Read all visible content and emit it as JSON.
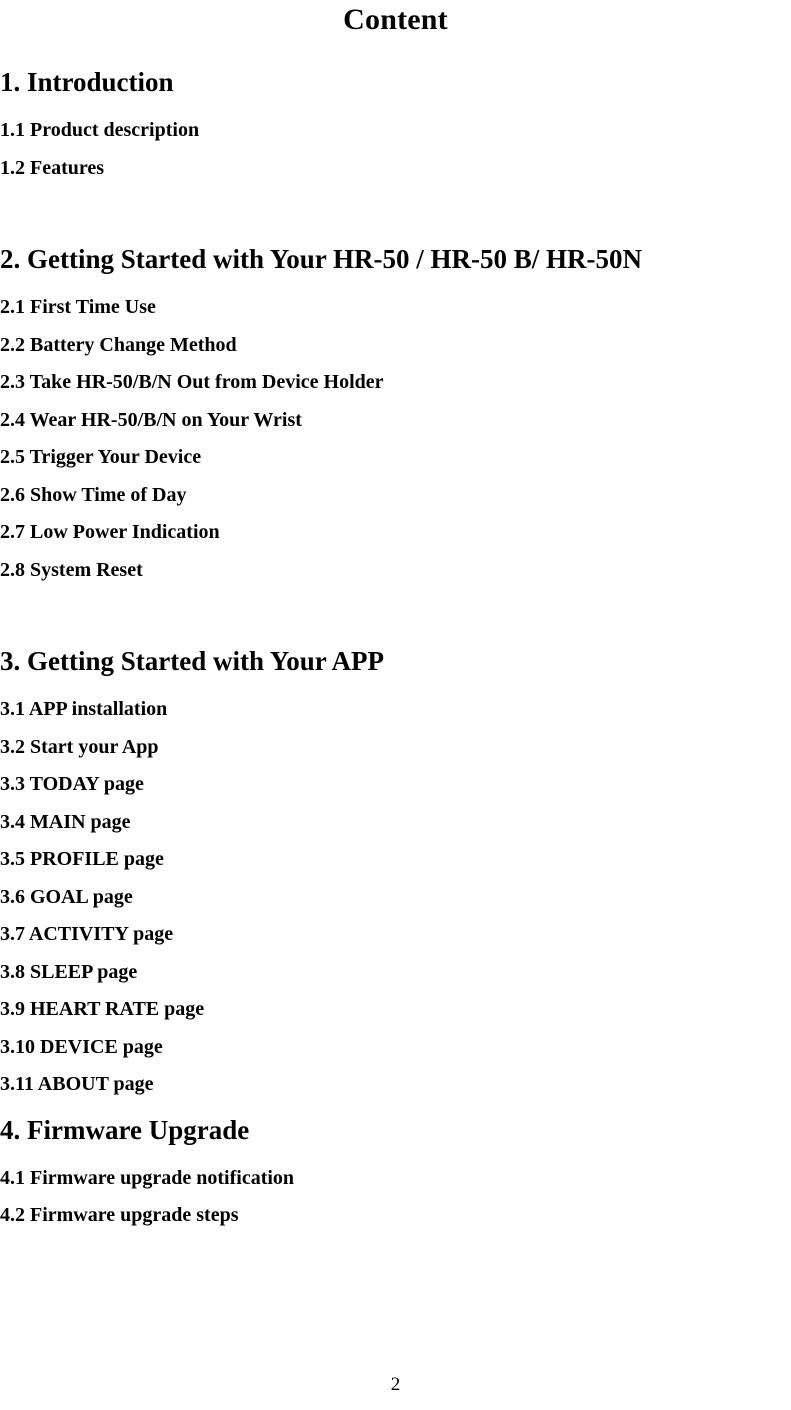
{
  "document": {
    "title": "Content",
    "page_number": "2",
    "text_color": "#000000",
    "background_color": "#ffffff"
  },
  "toc": {
    "sections": [
      {
        "heading": "1. Introduction",
        "entries": [
          "1.1 Product description",
          "1.2 Features"
        ]
      },
      {
        "heading": "2. Getting Started with Your HR-50 / HR-50 B/ HR-50N",
        "entries": [
          "2.1 First Time Use",
          "2.2 Battery Change Method",
          "2.3 Take HR-50/B/N Out from Device Holder",
          "2.4 Wear HR-50/B/N on Your Wrist",
          "2.5 Trigger Your Device",
          "2.6 Show Time of Day",
          "2.7 Low Power Indication",
          "2.8 System Reset"
        ]
      },
      {
        "heading": "3. Getting Started with Your APP",
        "entries": [
          "3.1 APP installation",
          "3.2 Start your App",
          "3.3 TODAY page",
          "3.4 MAIN page",
          "3.5 PROFILE page",
          "3.6 GOAL page",
          "3.7 ACTIVITY page",
          "3.8 SLEEP page",
          "3.9 HEART RATE page",
          "3.10 DEVICE page",
          "3.11 ABOUT page"
        ]
      },
      {
        "heading": "4. Firmware Upgrade",
        "entries": [
          "4.1 Firmware upgrade notification",
          "4.2 Firmware upgrade steps"
        ]
      }
    ]
  }
}
